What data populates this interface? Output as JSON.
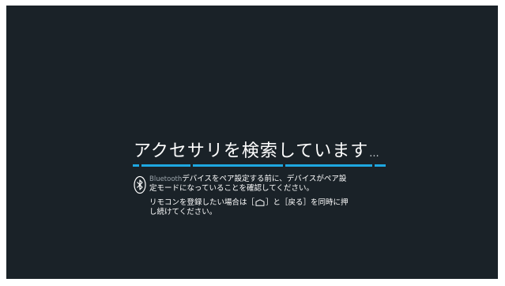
{
  "search": {
    "title": "アクセサリを検索しています",
    "ellipsis": "...",
    "progress_segments": 5
  },
  "message": {
    "bluetooth_word": "Bluetooth",
    "line1_rest": "デバイスをペア設定する前に、デバイスがペア設",
    "line2": "定モードになっていることを確認してください。",
    "line3_before": "リモコンを登録したい場合は［",
    "line3_after": "］と［戻る］を同時に押",
    "line4": "し続けてください。"
  },
  "icons": {
    "bluetooth": "bluetooth-icon",
    "home": "home-icon"
  },
  "colors": {
    "background": "#1a2228",
    "accent": "#1ea7e1",
    "text": "#ffffff"
  }
}
